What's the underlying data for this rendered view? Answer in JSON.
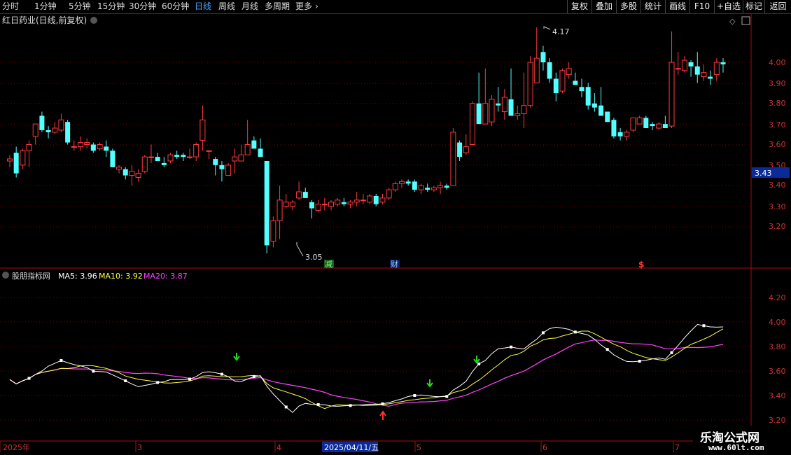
{
  "toolbar": {
    "periods": [
      "分时",
      "1分钟",
      "5分钟",
      "15分钟",
      "30分钟",
      "60分钟",
      "日线",
      "周线",
      "月线",
      "多周期",
      "更多"
    ],
    "active_period": "日线",
    "right_buttons": [
      "复权",
      "叠加",
      "多股",
      "统计",
      "画线",
      "F10",
      "+自选",
      "返回"
    ]
  },
  "main_chart": {
    "title": "红日药业(日线,前复权)",
    "price_ticks": [
      "4.00",
      "3.90",
      "3.80",
      "3.70",
      "3.60",
      "3.50",
      "3.40",
      "3.30",
      "3.20"
    ],
    "current_price_label": "3.43",
    "high_label": "4.17",
    "low_label": "3.05",
    "markers": {
      "jian": "减",
      "cai": "财",
      "dollar": "$"
    },
    "colors": {
      "up": "#ff3c3c",
      "down": "#54ffff",
      "grid": "#8b0000",
      "axis": "#a01010"
    }
  },
  "indicator": {
    "name": "股朋指标网",
    "ma5_label": "MA5: 3.96",
    "ma10_label": "MA10: 3.92",
    "ma20_label": "MA20: 3.87",
    "ticks": [
      "4.20",
      "4.00",
      "3.80",
      "3.60",
      "3.40",
      "3.20"
    ],
    "colors": {
      "ma5": "#ffffff",
      "ma10": "#ffff44",
      "ma20": "#ff44ff"
    }
  },
  "time_axis": {
    "labels": [
      "2025年",
      "3",
      "4",
      "5",
      "6",
      "7"
    ],
    "cursor_date": "2025/04/11/五"
  },
  "watermark": {
    "text": "乐淘公式网",
    "url": "www.60lt.com"
  }
}
